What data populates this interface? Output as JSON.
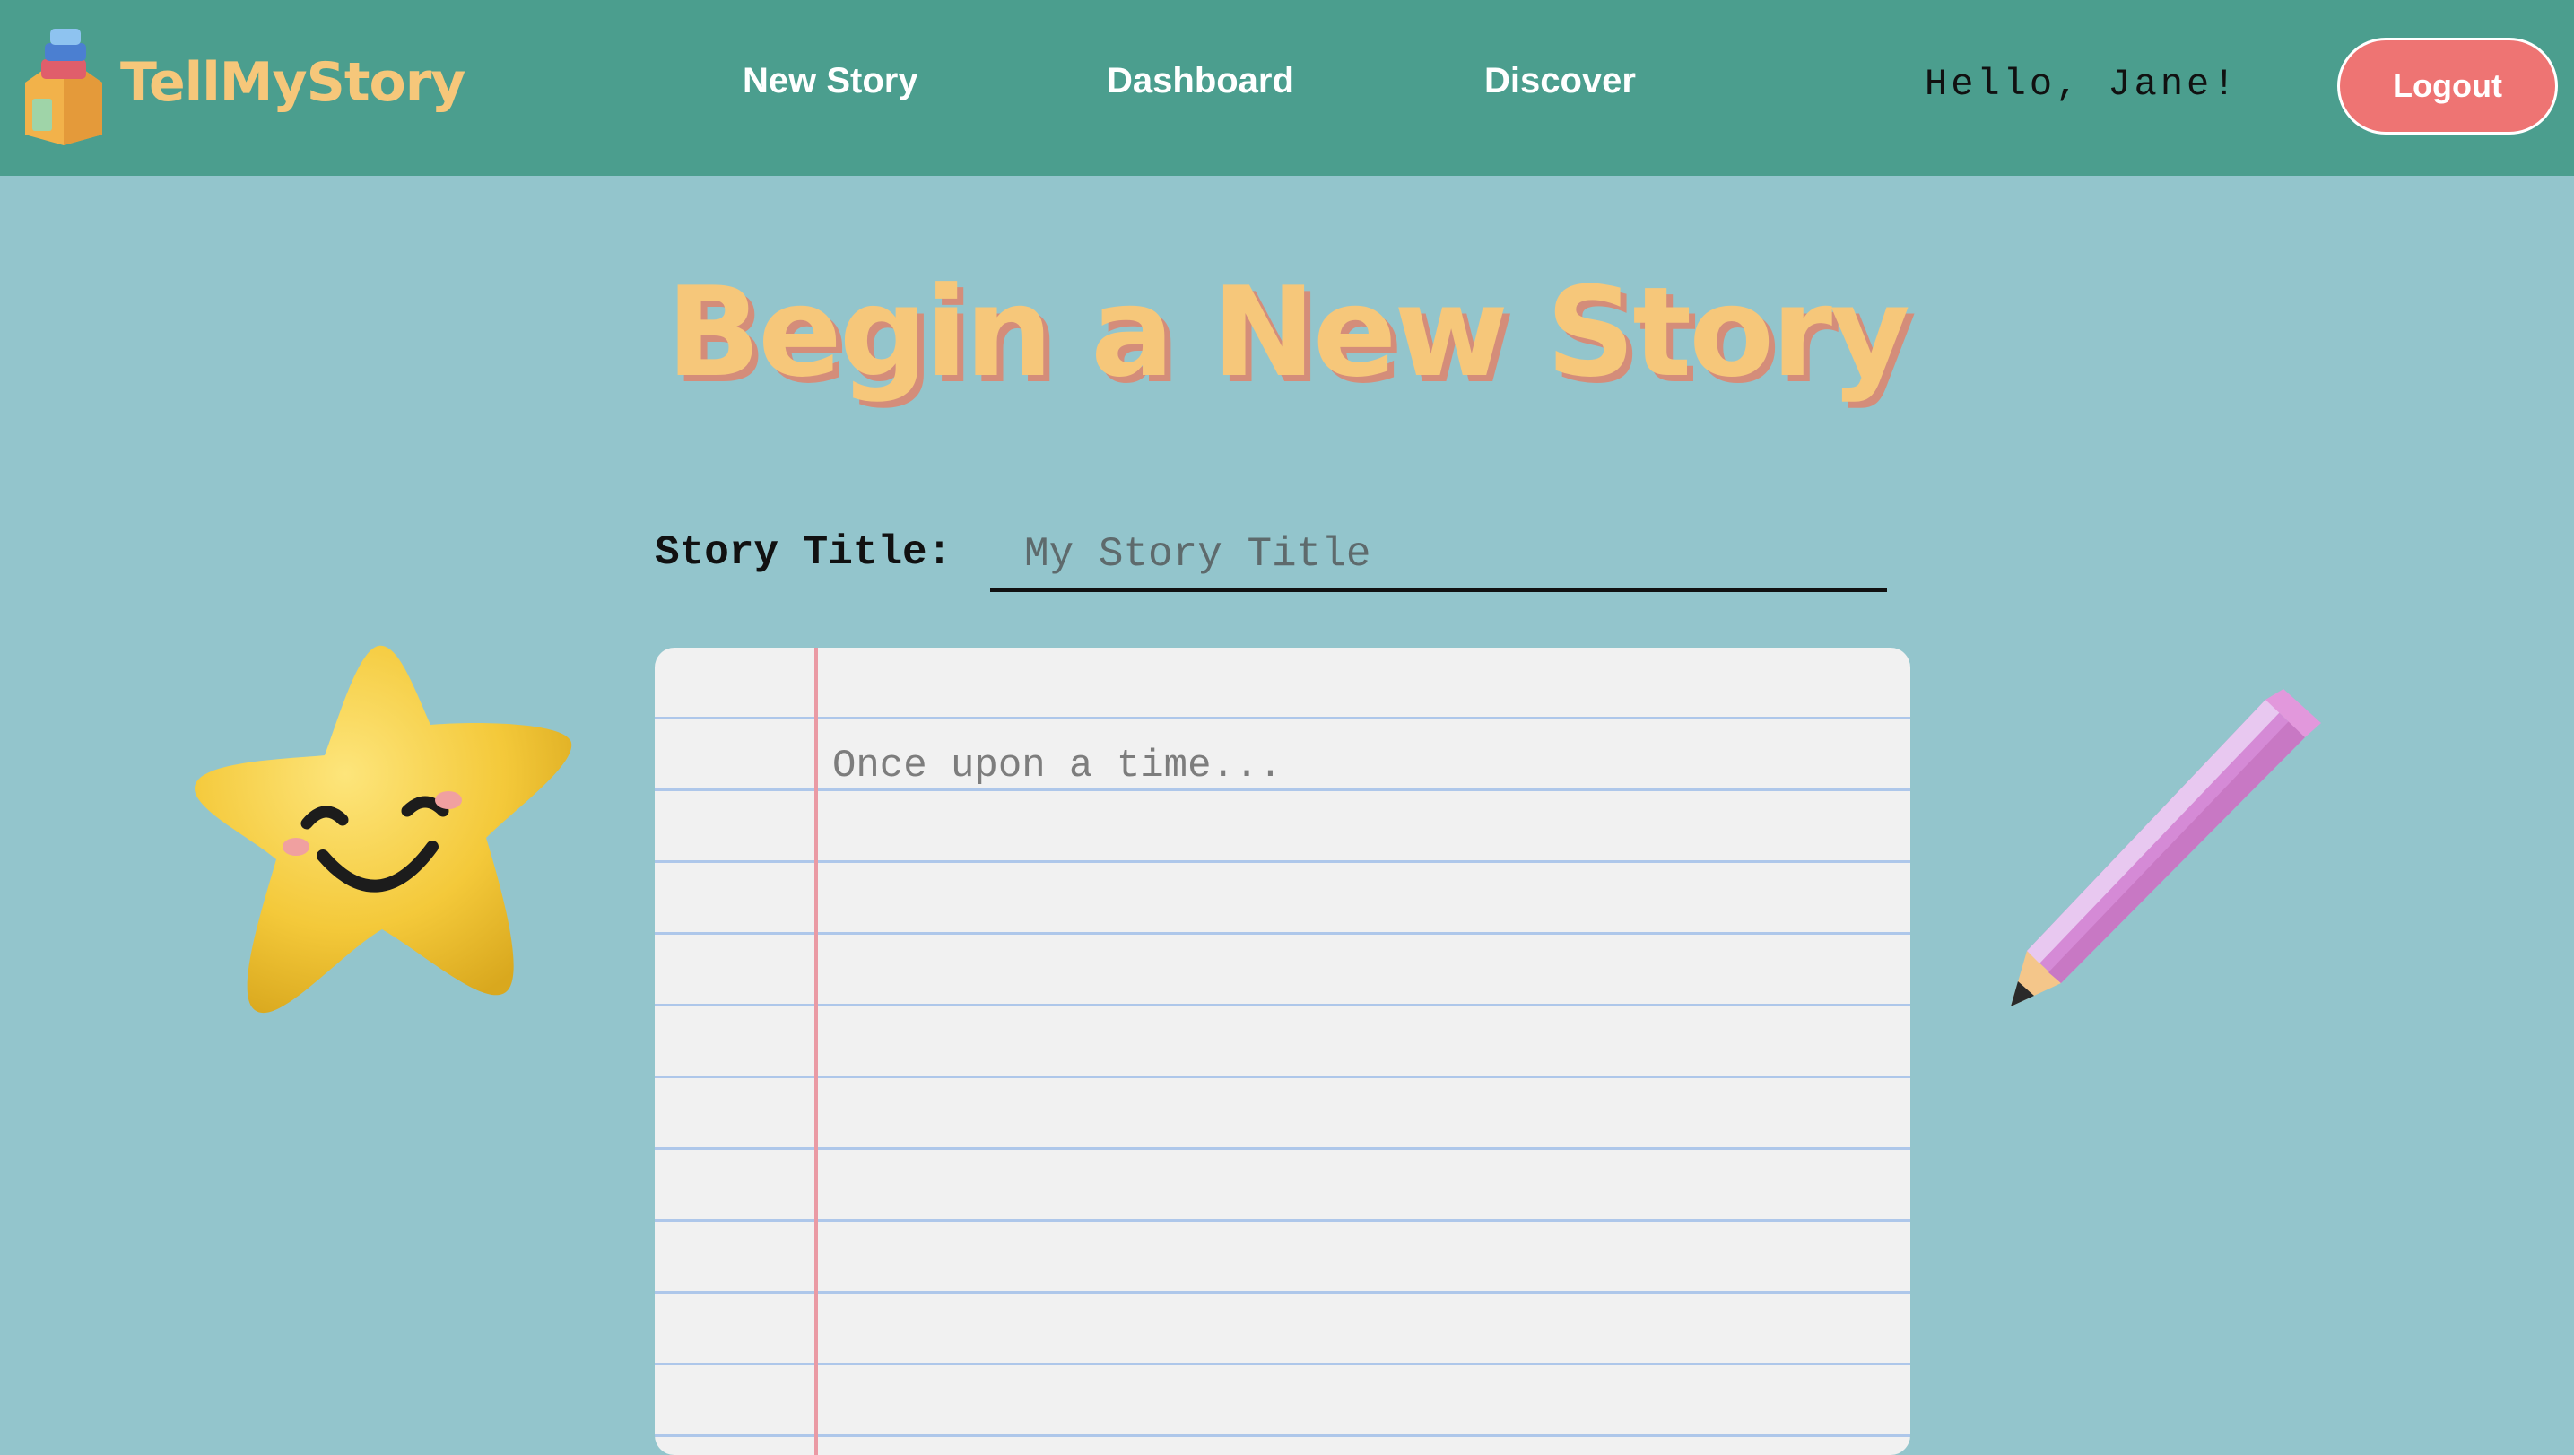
{
  "header": {
    "brand": "TellMyStory",
    "nav": [
      {
        "label": "New Story"
      },
      {
        "label": "Dashboard"
      },
      {
        "label": "Discover"
      }
    ],
    "greeting": "Hello, Jane!",
    "logout_label": "Logout"
  },
  "main": {
    "title": "Begin a New Story",
    "story_title_label": "Story Title:",
    "story_title_placeholder": "My Story Title",
    "story_title_value": "",
    "story_body_placeholder": "Once upon a time...",
    "story_body_value": ""
  },
  "colors": {
    "navbar": "#4b9e8e",
    "background": "#93c5cc",
    "brand": "#f6c77a",
    "logout": "#ee7473"
  },
  "icons": {
    "logo": "books-house-logo-icon",
    "star": "smiling-star-icon",
    "pencil": "pencil-icon"
  }
}
